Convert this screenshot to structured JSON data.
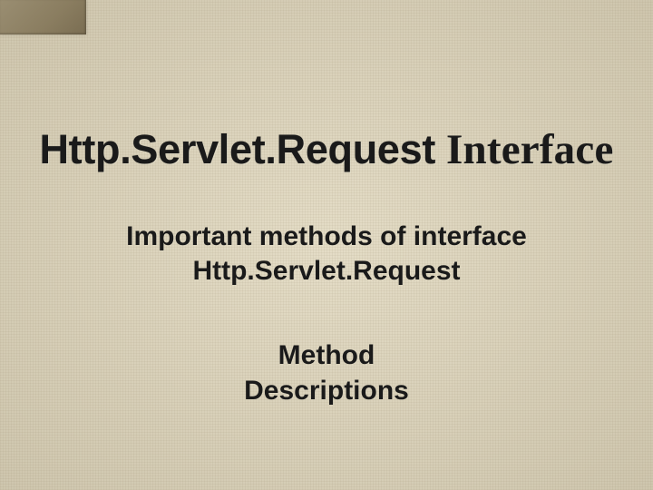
{
  "slide": {
    "title_part1": "Http.Servlet.Request",
    "title_part2": "Interface",
    "subtitle_line1": "Important methods of interface",
    "subtitle_line2": "Http.Servlet.Request",
    "section_line1": "Method",
    "section_line2": "Descriptions"
  }
}
